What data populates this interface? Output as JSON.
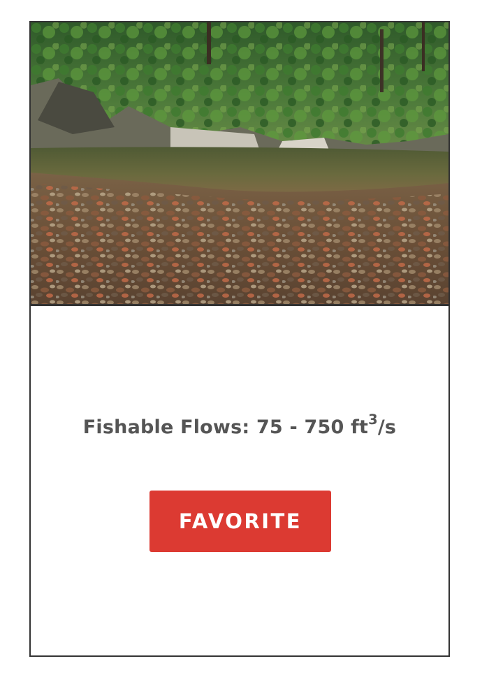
{
  "card": {
    "photo_alt": "river scene",
    "flows_prefix": "Fishable Flows: 75 - 750 ft",
    "flows_exponent": "3",
    "flows_suffix": "/s",
    "favorite_label": "FAVORITE"
  },
  "colors": {
    "button_bg": "#dc3a32",
    "text": "#555555",
    "border": "#333333"
  }
}
